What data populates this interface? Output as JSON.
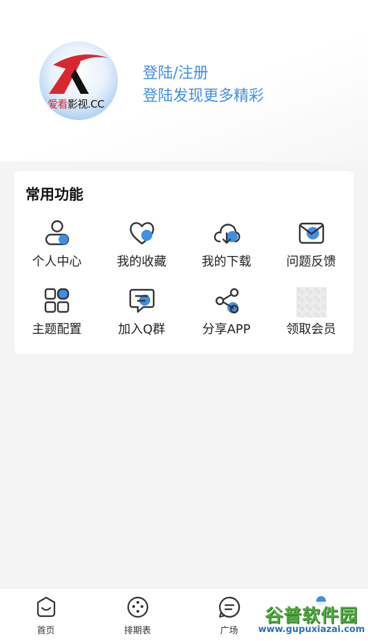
{
  "profile": {
    "logo_text_red": "爱看",
    "logo_text_dark": "影视.CC",
    "login_title": "登陆/注册",
    "login_subtitle": "登陆发现更多精彩"
  },
  "common_functions": {
    "title": "常用功能",
    "items": [
      {
        "label": "个人中心",
        "icon": "user-icon"
      },
      {
        "label": "我的收藏",
        "icon": "heart-icon"
      },
      {
        "label": "我的下载",
        "icon": "cloud-download-icon"
      },
      {
        "label": "问题反馈",
        "icon": "mail-icon"
      },
      {
        "label": "主题配置",
        "icon": "grid-icon"
      },
      {
        "label": "加入Q群",
        "icon": "chat-icon"
      },
      {
        "label": "分享APP",
        "icon": "share-icon"
      },
      {
        "label": "领取会员",
        "icon": "image-placeholder"
      }
    ]
  },
  "tabbar": {
    "items": [
      {
        "label": "首页",
        "icon": "home-icon"
      },
      {
        "label": "排期表",
        "icon": "schedule-icon"
      },
      {
        "label": "广场",
        "icon": "square-icon"
      },
      {
        "label": "",
        "icon": "mine-icon"
      }
    ]
  },
  "watermark": {
    "main": "谷普软件园",
    "url": "www.gupuxiazai.com"
  },
  "colors": {
    "accent": "#3e8fe6",
    "icon_stroke": "#333333",
    "brand_red": "#d8282f"
  }
}
